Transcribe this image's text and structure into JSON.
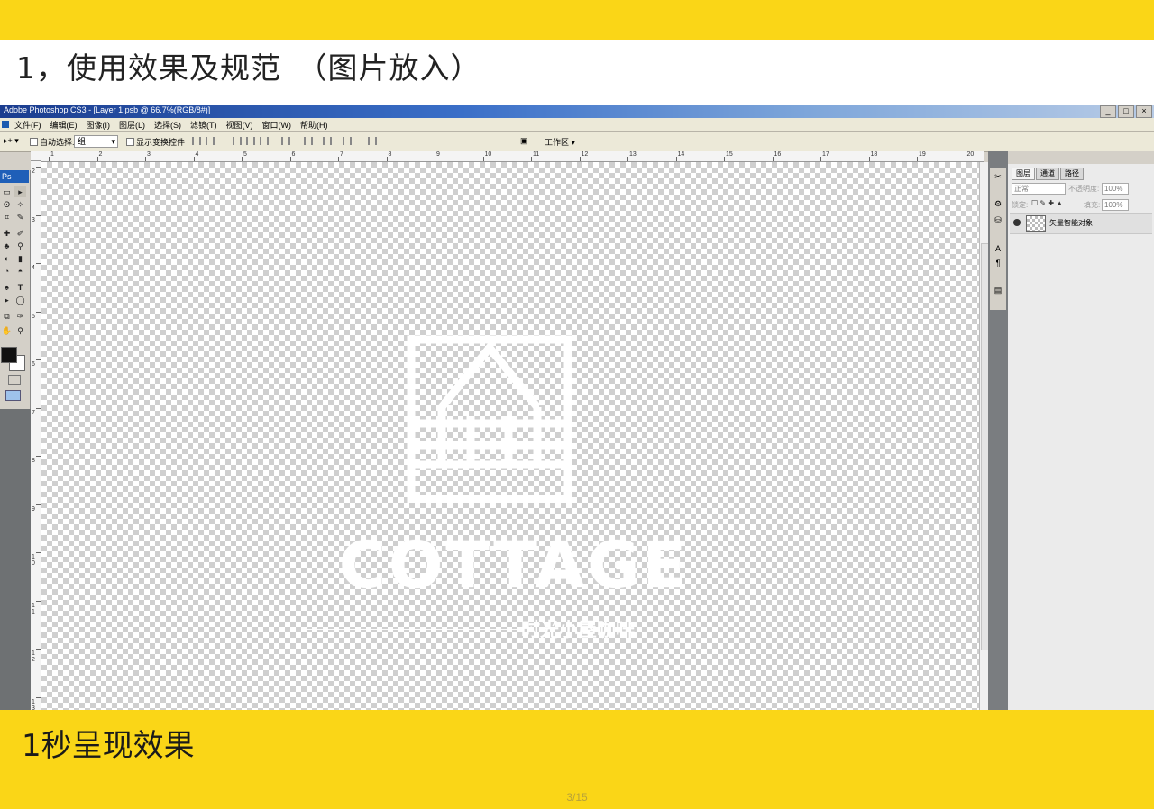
{
  "slide": {
    "title": "1，使用效果及规范　（图片放入）",
    "caption": "1秒呈现效果",
    "page_number": "3/15"
  },
  "window": {
    "title": "Adobe Photoshop CS3 - [Layer 1.psb @ 66.7%(RGB/8#)]",
    "buttons": [
      "_",
      "□",
      "×"
    ]
  },
  "menu": [
    "文件(F)",
    "编辑(E)",
    "图像(I)",
    "图层(L)",
    "选择(S)",
    "滤镜(T)",
    "视图(V)",
    "窗口(W)",
    "帮助(H)"
  ],
  "options": {
    "auto_select_label": "自动选择:",
    "auto_select_value": "组",
    "show_transform_label": "显示变换控件",
    "workspace_label": "工作区"
  },
  "toolbox": {
    "logo": "Ps",
    "tools": [
      "▭",
      "▸",
      "ʘ",
      "✧",
      "⌗",
      "✎",
      "✚",
      "✐",
      "♣",
      "⚲",
      "◐",
      "▮",
      "◔",
      "◓",
      "♠",
      "T",
      "▸",
      "◯",
      "⧉",
      "✑",
      "✋",
      "⚲"
    ]
  },
  "rulers": {
    "top": [
      "1",
      "2",
      "3",
      "4",
      "5",
      "6",
      "7",
      "8",
      "9",
      "10",
      "11",
      "12",
      "13",
      "14",
      "15",
      "16",
      "17",
      "18",
      "19",
      "20"
    ],
    "left": [
      "2",
      "3",
      "4",
      "5",
      "6",
      "7",
      "8",
      "9",
      "1 0",
      "1 1",
      "1 2",
      "1 3"
    ]
  },
  "canvas": {
    "brand": "COTTAGE",
    "tagline_cn": "时光小屋咖啡"
  },
  "dock_icons": [
    "✂",
    "⚙",
    "⛁",
    "A",
    "¶",
    "▤"
  ],
  "layers_panel": {
    "tabs": [
      "图层",
      "通道",
      "路径"
    ],
    "blend_mode": "正常",
    "opacity_label": "不透明度:",
    "opacity_value": "100%",
    "lock_label": "锁定:",
    "fill_label": "填充:",
    "fill_value": "100%",
    "layer_name": "矢量智能对象"
  }
}
